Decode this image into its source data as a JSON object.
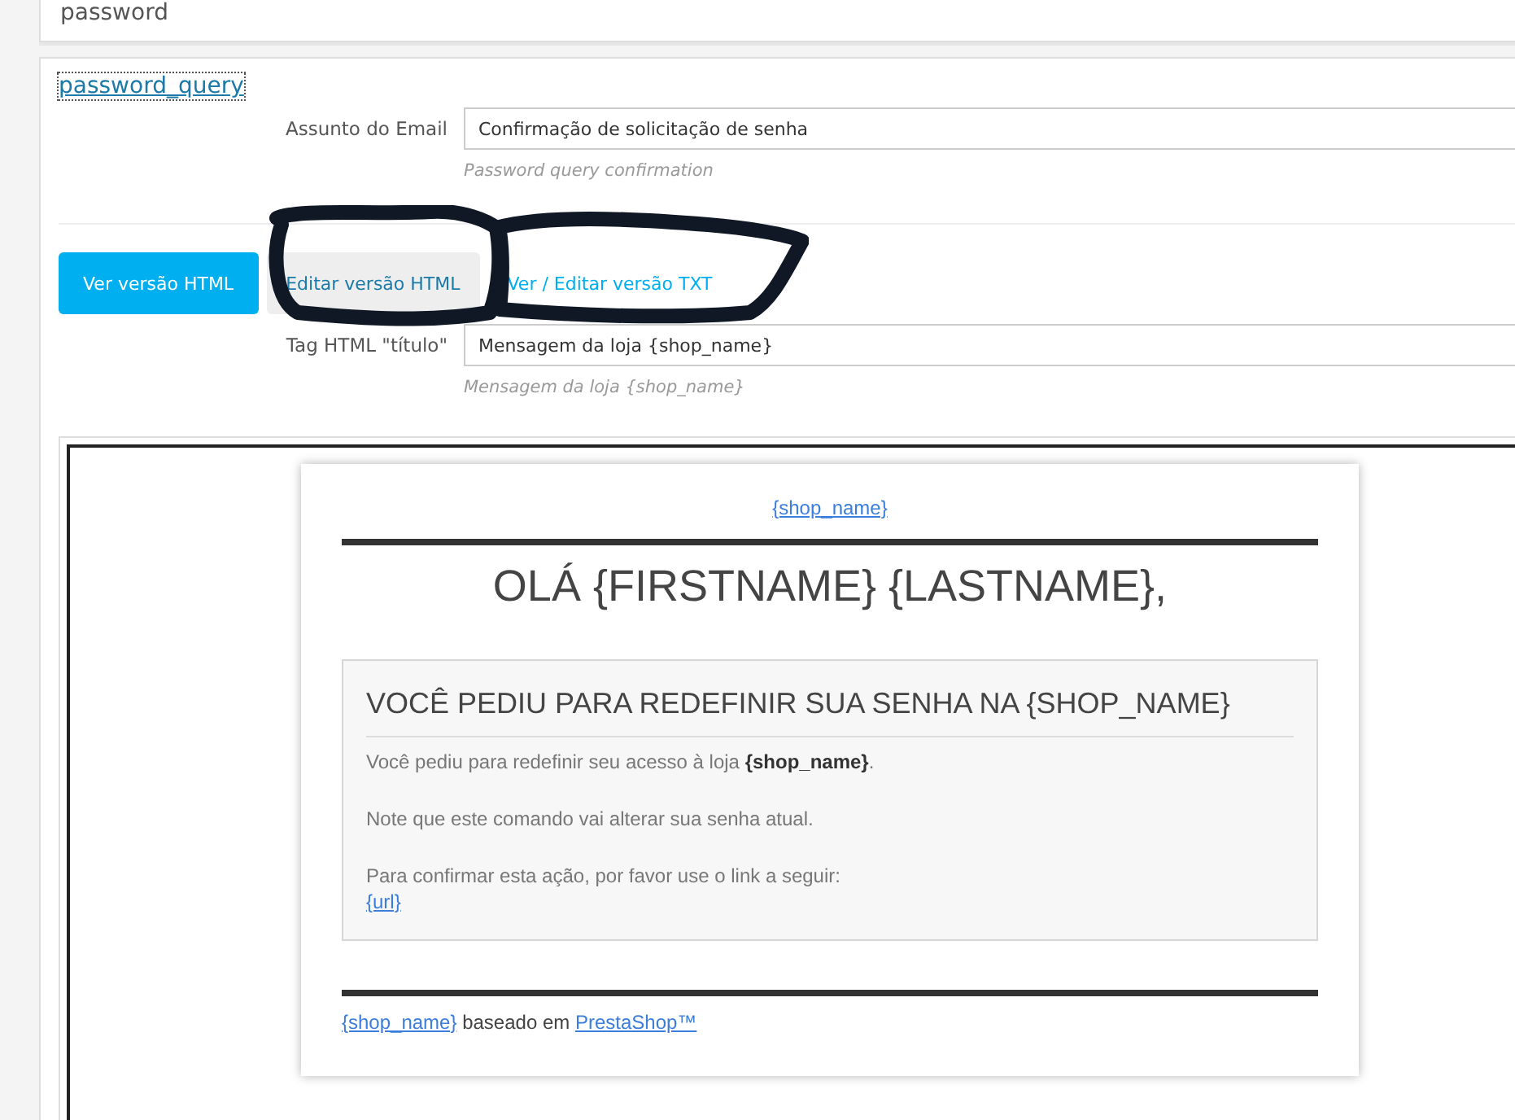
{
  "header": {
    "title": "password"
  },
  "template": {
    "name": "password_query",
    "subject": {
      "label": "Assunto do Email",
      "value": "Confirmação de solicitação de senha",
      "hint": "Password query confirmation"
    },
    "tabs": [
      {
        "label": "Ver versão HTML",
        "selected": true,
        "hovered": false
      },
      {
        "label": "Editar versão HTML",
        "selected": false,
        "hovered": true
      },
      {
        "label": "Ver / Editar versão TXT",
        "selected": false,
        "hovered": false
      }
    ],
    "title_tag": {
      "label": "Tag HTML \"título\"",
      "value": "Mensagem da loja {shop_name}",
      "hint": "Mensagem da loja {shop_name}"
    },
    "preview": {
      "shop_link": "{shop_name}",
      "greeting": "OLÁ {FIRSTNAME} {LASTNAME},",
      "box_title": "VOCÊ PEDIU PARA REDEFINIR SUA SENHA NA {SHOP_NAME}",
      "paragraphs": [
        "Você pediu para redefinir seu acesso à loja **{shop_name}**.",
        "Note que este comando vai alterar sua senha atual.",
        "Para confirmar esta ação, por favor use o link a seguir:"
      ],
      "url_link": "{url}",
      "footer": {
        "shop_link": "{shop_name}",
        "text": "baseado em",
        "brand_link": "PrestaShop™"
      }
    }
  }
}
